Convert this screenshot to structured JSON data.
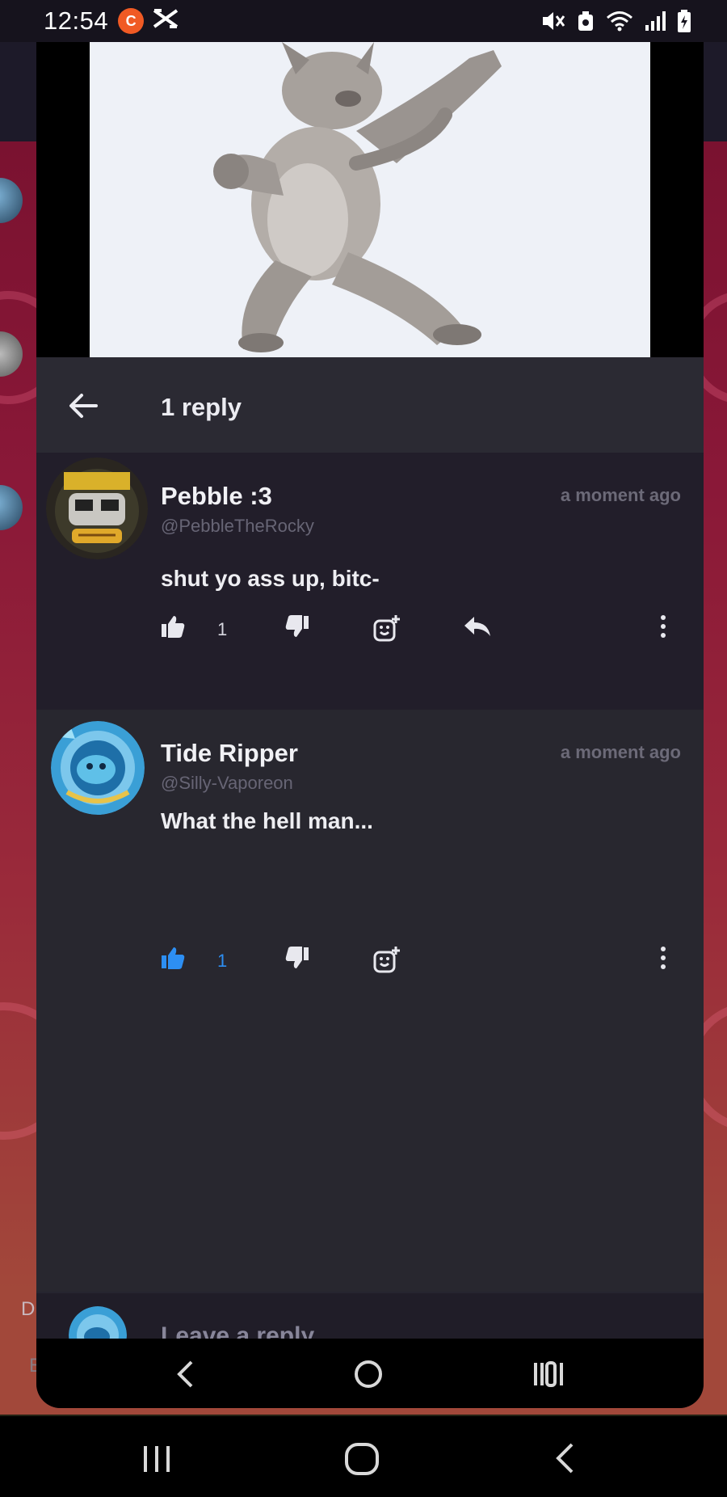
{
  "status_bar": {
    "time": "12:54",
    "recording_badge": "C"
  },
  "thread": {
    "title": "1 reply"
  },
  "comments": [
    {
      "author": "Pebble :3",
      "handle": "@PebbleTheRocky",
      "time": "a moment ago",
      "text": "shut yo ass up, bitc-",
      "likes": "1",
      "liked": false
    },
    {
      "author": "Tide Ripper",
      "handle": "@Silly-Vaporeon",
      "time": "a moment ago",
      "text": "What the hell man...",
      "likes": "1",
      "liked": true
    }
  ],
  "reply_bar": {
    "placeholder": "Leave a reply"
  },
  "background": {
    "peek_letter_1": "D",
    "peek_letter_2": "E"
  },
  "colors": {
    "like_active": "#2d8ff3",
    "panel": "#28272f",
    "parent_panel": "#221e2a",
    "accent_badge": "#f05a24"
  }
}
